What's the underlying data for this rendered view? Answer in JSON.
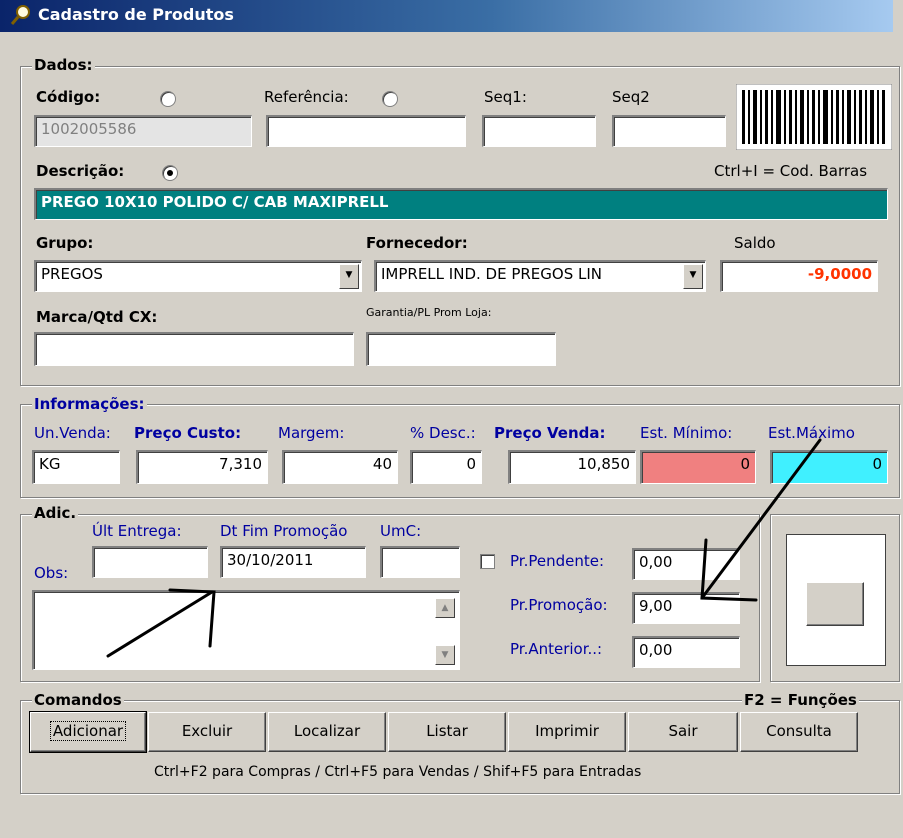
{
  "window": {
    "title": "Cadastro de Produtos"
  },
  "dados": {
    "legend": "Dados:",
    "codigo_label": "Código:",
    "codigo_value": "1002005586",
    "referencia_label": "Referência:",
    "seq1_label": "Seq1:",
    "seq2_label": "Seq2",
    "descricao_label": "Descrição:",
    "barcode_hint": "Ctrl+I = Cod. Barras",
    "descricao_value": "PREGO 10X10 POLIDO C/ CAB MAXIPRELL",
    "grupo_label": "Grupo:",
    "grupo_value": "PREGOS",
    "fornecedor_label": "Fornecedor:",
    "fornecedor_value": "IMPRELL IND. DE PREGOS LIN",
    "saldo_label": "Saldo",
    "saldo_value": "-9,0000",
    "marca_label": "Marca/Qtd CX:",
    "garantia_label": "Garantia/PL Prom Loja:"
  },
  "informacoes": {
    "legend": "Informações:",
    "un_venda_label": "Un.Venda:",
    "un_venda_value": "KG",
    "preco_custo_label": "Preço Custo:",
    "preco_custo_value": "7,310",
    "margem_label": "Margem:",
    "margem_value": "40",
    "desc_label": "% Desc.:",
    "desc_value": "0",
    "preco_venda_label": "Preço Venda:",
    "preco_venda_value": "10,850",
    "est_minimo_label": "Est. Mínimo:",
    "est_minimo_value": "0",
    "est_maximo_label": "Est.Máximo",
    "est_maximo_value": "0"
  },
  "adic": {
    "legend": "Adic.",
    "ult_entrega_label": "Últ Entrega:",
    "dt_fim_label": "Dt Fim Promoção",
    "dt_fim_value": "30/10/2011",
    "umc_label": "UmC:",
    "obs_label": "Obs:",
    "pr_pendente_label": "Pr.Pendente:",
    "pr_pendente_value": "0,00",
    "pr_promocao_label": "Pr.Promoção:",
    "pr_promocao_value": "9,00",
    "pr_anterior_label": "Pr.Anterior..:",
    "pr_anterior_value": "0,00"
  },
  "comandos": {
    "legend": "Comandos",
    "funcoes_hint": "F2 = Funções",
    "buttons": [
      "Adicionar",
      "Excluir",
      "Localizar",
      "Listar",
      "Imprimir",
      "Sair",
      "Consulta"
    ],
    "shortcuts": "Ctrl+F2 para Compras / Ctrl+F5 para Vendas / Shif+F5 para Entradas"
  },
  "colors": {
    "descricao_bg": "#008080",
    "est_minimo_bg": "#f08080",
    "est_maximo_bg": "#40f0ff",
    "saldo_fg": "#ff3300"
  },
  "icons": [
    "magnifier-icon",
    "barcode-icon",
    "dropdown-arrow-icon",
    "scroll-up-icon",
    "scroll-down-icon"
  ]
}
